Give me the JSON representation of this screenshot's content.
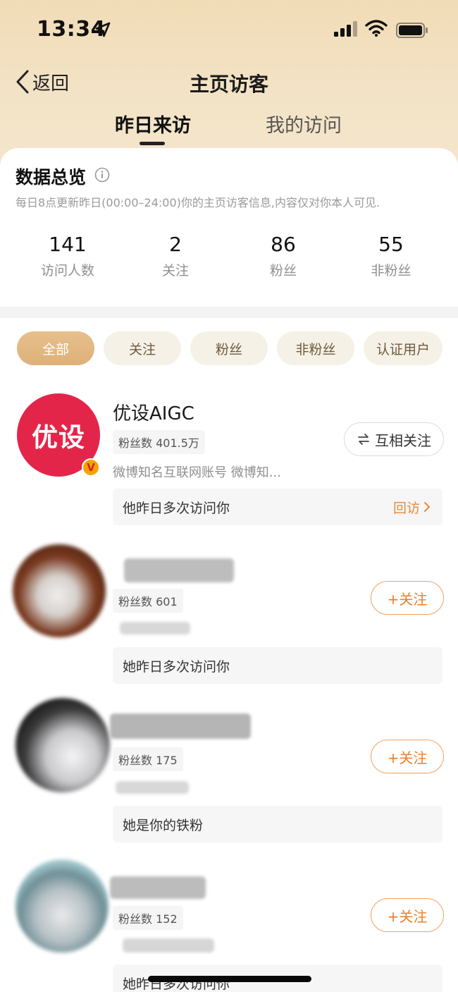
{
  "status_bar": {
    "time": "13:34"
  },
  "nav": {
    "back_label": "返回",
    "title": "主页访客"
  },
  "tabs": [
    {
      "label": "昨日来访",
      "active": true
    },
    {
      "label": "我的访问",
      "active": false
    }
  ],
  "overview": {
    "title": "数据总览",
    "description": "每日8点更新昨日(00:00–24:00)你的主页访客信息,内容仅对你本人可见.",
    "stats": [
      {
        "value": "141",
        "label": "访问人数"
      },
      {
        "value": "2",
        "label": "关注"
      },
      {
        "value": "86",
        "label": "粉丝"
      },
      {
        "value": "55",
        "label": "非粉丝"
      }
    ]
  },
  "filters": [
    {
      "label": "全部",
      "active": true
    },
    {
      "label": "关注",
      "active": false
    },
    {
      "label": "粉丝",
      "active": false
    },
    {
      "label": "非粉丝",
      "active": false
    },
    {
      "label": "认证用户",
      "active": false
    }
  ],
  "visitors": [
    {
      "avatar_text": "优设",
      "name": "优设AIGC",
      "fans": "粉丝数 401.5万",
      "description": "微博知名互联网账号 微博知...",
      "action": "互相关注",
      "message": "他昨日多次访问你",
      "revisit": "回访",
      "verified_badge": "V"
    },
    {
      "fans": "粉丝数 601",
      "action": "+关注",
      "message": "她昨日多次访问你"
    },
    {
      "fans": "粉丝数 175",
      "action": "+关注",
      "message": "她是你的铁粉"
    },
    {
      "fans": "粉丝数 152",
      "action": "+关注",
      "message": "她昨日多次访问你"
    }
  ],
  "colors": {
    "accent": "#eb7f2a",
    "chip_active": "#deb079",
    "brand_avatar": "#e4254a",
    "header_bg": "#f1dcb6"
  },
  "icons": {
    "back": "chevron-left-icon",
    "info": "info-icon",
    "mutual": "swap-arrows-icon",
    "revisit_arrow": "chevron-right-icon",
    "verified": "verified-badge-icon"
  }
}
